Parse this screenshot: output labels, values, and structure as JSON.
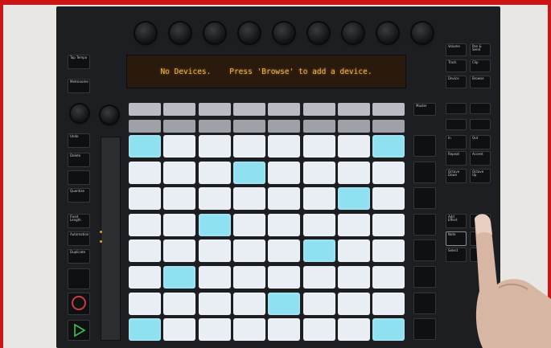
{
  "display": {
    "text": "No Devices.    Press 'Browse' to add a device."
  },
  "colors": {
    "pad": "#e9eef4",
    "pad_blue": "#8fe0f0",
    "display_text": "#e8b65a",
    "frame": "#cc1616"
  },
  "left_buttons": [
    "Tap Tempo",
    "Metronome",
    "Undo",
    "Delete",
    "",
    "Quantize",
    "Fixed Length",
    "Automation",
    "Duplicate",
    "",
    "",
    ""
  ],
  "right_top_buttons": [
    "Volume",
    "Pan & Send",
    "Track",
    "Clip",
    "Device",
    "Browse"
  ],
  "right_mid_buttons": [
    "In",
    "Out",
    "Repeat",
    "Accent",
    "Octave Down",
    "Octave Up",
    "Add Effect",
    "",
    "Note",
    "",
    "Select",
    ""
  ],
  "scene_label": "Master",
  "pads": {
    "blue": [
      [
        0,
        0
      ],
      [
        0,
        7
      ],
      [
        1,
        3
      ],
      [
        2,
        6
      ],
      [
        3,
        2
      ],
      [
        4,
        5
      ],
      [
        5,
        1
      ],
      [
        6,
        4
      ],
      [
        7,
        0
      ],
      [
        7,
        7
      ]
    ]
  },
  "icons": {
    "record": "circle-record-icon",
    "play": "play-triangle-icon"
  }
}
